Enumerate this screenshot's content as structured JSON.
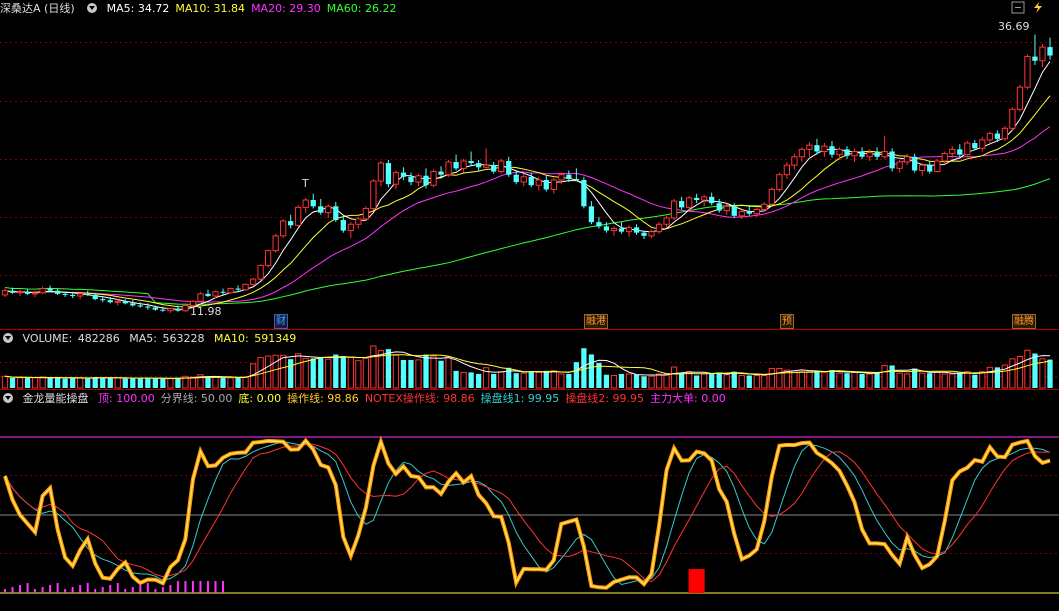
{
  "main": {
    "stock_name": "深桑达A",
    "period": "(日线)",
    "ma": [
      {
        "label": "MA5:",
        "value": "34.72",
        "color": "#ffffff"
      },
      {
        "label": "MA10:",
        "value": "31.84",
        "color": "#ffff33"
      },
      {
        "label": "MA20:",
        "value": "29.30",
        "color": "#ff33ff"
      },
      {
        "label": "MA60:",
        "value": "26.22",
        "color": "#33ff33"
      }
    ],
    "high_label": "36.69",
    "low_label": "11.98",
    "t_marker": "T",
    "tags": [
      {
        "text": "财",
        "color": "#33aaff"
      },
      {
        "text": "融港",
        "color": "#ff9933"
      },
      {
        "text": "预",
        "color": "#ff9933"
      },
      {
        "text": "融腾",
        "color": "#ff9933"
      }
    ]
  },
  "volume": {
    "title": "VOLUME:",
    "value": "482286",
    "ma5_label": "MA5:",
    "ma5": "563228",
    "ma10_label": "MA10:",
    "ma10": "591349"
  },
  "indicator": {
    "name": "金龙量能操盘",
    "items": [
      {
        "label": "顶:",
        "value": "100.00",
        "color": "#ff33ff"
      },
      {
        "label": "分界线:",
        "value": "50.00",
        "color": "#aaaaaa"
      },
      {
        "label": "底:",
        "value": "0.00",
        "color": "#ffff33"
      },
      {
        "label": "操作线:",
        "value": "98.86",
        "color": "#ffcc33"
      },
      {
        "label": "NOTEX操作线:",
        "value": "98.86",
        "color": "#ff3333"
      },
      {
        "label": "操盘线1:",
        "value": "99.95",
        "color": "#33cccc"
      },
      {
        "label": "操盘线2:",
        "value": "99.95",
        "color": "#ff3333"
      },
      {
        "label": "主力大单:",
        "value": "0.00",
        "color": "#ff33ff"
      }
    ]
  },
  "chart_data": {
    "type": "candlestick",
    "candles": [
      [
        12.0,
        12.6,
        11.8,
        12.4
      ],
      [
        12.4,
        12.7,
        12.1,
        12.2
      ],
      [
        12.2,
        12.5,
        11.9,
        12.3
      ],
      [
        12.3,
        12.6,
        12.0,
        12.1
      ],
      [
        12.1,
        12.4,
        11.8,
        12.2
      ],
      [
        12.2,
        12.8,
        12.1,
        12.6
      ],
      [
        12.6,
        12.9,
        12.3,
        12.4
      ],
      [
        12.4,
        12.6,
        12.0,
        12.1
      ],
      [
        12.1,
        12.3,
        11.8,
        12.0
      ],
      [
        12.0,
        12.3,
        11.7,
        11.9
      ],
      [
        11.9,
        12.2,
        11.6,
        12.1
      ],
      [
        12.1,
        12.4,
        11.9,
        12.0
      ],
      [
        12.0,
        12.2,
        11.5,
        11.6
      ],
      [
        11.6,
        11.9,
        11.3,
        11.5
      ],
      [
        11.5,
        11.8,
        11.2,
        11.3
      ],
      [
        11.3,
        11.6,
        11.0,
        11.4
      ],
      [
        11.4,
        11.6,
        11.1,
        11.2
      ],
      [
        11.2,
        11.5,
        10.9,
        11.0
      ],
      [
        11.0,
        11.3,
        10.8,
        10.9
      ],
      [
        10.9,
        11.2,
        10.6,
        10.8
      ],
      [
        10.8,
        11.0,
        10.5,
        10.6
      ],
      [
        10.6,
        10.9,
        10.4,
        10.5
      ],
      [
        10.5,
        10.8,
        10.3,
        10.7
      ],
      [
        10.7,
        11.0,
        10.4,
        10.5
      ],
      [
        10.5,
        11.2,
        10.4,
        11.0
      ],
      [
        11.0,
        11.5,
        10.8,
        11.4
      ],
      [
        11.4,
        12.3,
        11.3,
        12.1
      ],
      [
        12.1,
        12.5,
        11.8,
        11.9
      ],
      [
        11.9,
        12.4,
        11.7,
        12.3
      ],
      [
        12.3,
        12.6,
        12.0,
        12.2
      ],
      [
        12.2,
        12.7,
        12.1,
        12.6
      ],
      [
        12.6,
        12.9,
        12.3,
        12.5
      ],
      [
        12.5,
        13.1,
        12.4,
        13.0
      ],
      [
        13.0,
        13.6,
        12.9,
        13.5
      ],
      [
        13.5,
        14.9,
        13.4,
        14.8
      ],
      [
        14.8,
        16.3,
        14.6,
        16.2
      ],
      [
        16.2,
        17.8,
        16.0,
        17.6
      ],
      [
        17.6,
        19.2,
        17.4,
        19.0
      ],
      [
        19.0,
        19.6,
        18.3,
        18.6
      ],
      [
        18.6,
        20.5,
        18.5,
        20.3
      ],
      [
        20.3,
        21.2,
        19.8,
        21.0
      ],
      [
        21.0,
        21.6,
        20.2,
        20.4
      ],
      [
        20.4,
        21.1,
        19.6,
        19.8
      ],
      [
        19.8,
        20.6,
        19.3,
        20.4
      ],
      [
        20.4,
        20.8,
        18.9,
        19.1
      ],
      [
        19.1,
        19.6,
        17.9,
        18.1
      ],
      [
        18.1,
        18.9,
        17.4,
        18.7
      ],
      [
        18.7,
        19.4,
        18.3,
        19.2
      ],
      [
        19.2,
        20.4,
        19.0,
        20.2
      ],
      [
        20.2,
        23.0,
        20.0,
        22.8
      ],
      [
        22.8,
        24.7,
        22.3,
        24.5
      ],
      [
        24.5,
        24.8,
        22.2,
        22.5
      ],
      [
        22.5,
        23.8,
        22.0,
        23.6
      ],
      [
        23.6,
        24.1,
        22.9,
        23.2
      ],
      [
        23.2,
        23.6,
        22.4,
        22.7
      ],
      [
        22.7,
        23.5,
        22.3,
        23.3
      ],
      [
        23.3,
        24.0,
        22.1,
        22.4
      ],
      [
        22.4,
        23.9,
        22.2,
        23.7
      ],
      [
        23.7,
        24.2,
        23.1,
        23.4
      ],
      [
        23.4,
        24.8,
        23.2,
        24.6
      ],
      [
        24.6,
        25.3,
        23.8,
        24.0
      ],
      [
        24.0,
        24.9,
        23.6,
        24.7
      ],
      [
        24.7,
        25.6,
        24.3,
        24.5
      ],
      [
        24.5,
        24.8,
        23.7,
        24.1
      ],
      [
        24.1,
        25.9,
        24.0,
        24.3
      ],
      [
        24.3,
        24.6,
        23.5,
        23.7
      ],
      [
        23.7,
        24.9,
        23.5,
        24.7
      ],
      [
        24.7,
        25.1,
        23.2,
        23.4
      ],
      [
        23.4,
        23.7,
        22.5,
        22.7
      ],
      [
        22.7,
        23.5,
        22.3,
        23.2
      ],
      [
        23.2,
        23.6,
        22.2,
        22.4
      ],
      [
        22.4,
        23.2,
        21.9,
        22.9
      ],
      [
        22.9,
        23.3,
        21.8,
        22.0
      ],
      [
        22.0,
        23.1,
        21.6,
        22.9
      ],
      [
        22.9,
        23.6,
        22.5,
        23.4
      ],
      [
        23.4,
        23.8,
        22.7,
        23.0
      ],
      [
        23.0,
        24.0,
        22.8,
        22.9
      ],
      [
        22.9,
        23.2,
        20.2,
        20.4
      ],
      [
        20.4,
        20.9,
        18.7,
        18.9
      ],
      [
        18.9,
        19.4,
        18.3,
        18.5
      ],
      [
        18.5,
        18.9,
        17.9,
        18.1
      ],
      [
        18.1,
        18.5,
        17.6,
        18.3
      ],
      [
        18.3,
        18.9,
        17.8,
        18.0
      ],
      [
        18.0,
        18.6,
        17.5,
        18.4
      ],
      [
        18.4,
        18.7,
        17.7,
        17.9
      ],
      [
        17.9,
        18.1,
        17.3,
        17.6
      ],
      [
        17.6,
        18.2,
        17.4,
        18.0
      ],
      [
        18.0,
        18.9,
        17.8,
        18.7
      ],
      [
        18.7,
        19.5,
        18.4,
        19.3
      ],
      [
        19.3,
        21.1,
        19.1,
        20.9
      ],
      [
        20.9,
        21.3,
        20.1,
        20.3
      ],
      [
        20.3,
        21.4,
        20.0,
        21.2
      ],
      [
        21.2,
        21.6,
        20.7,
        21.0
      ],
      [
        21.0,
        21.5,
        20.4,
        21.3
      ],
      [
        21.3,
        21.7,
        20.5,
        20.7
      ],
      [
        20.7,
        21.1,
        19.8,
        20.0
      ],
      [
        20.0,
        20.6,
        19.6,
        20.4
      ],
      [
        20.4,
        20.7,
        19.3,
        19.5
      ],
      [
        19.5,
        20.1,
        19.2,
        19.9
      ],
      [
        19.9,
        20.4,
        19.5,
        19.7
      ],
      [
        19.7,
        20.3,
        19.4,
        20.1
      ],
      [
        20.1,
        20.8,
        19.9,
        20.6
      ],
      [
        20.6,
        22.2,
        20.4,
        22.0
      ],
      [
        22.0,
        23.6,
        21.8,
        23.4
      ],
      [
        23.4,
        24.6,
        23.0,
        24.3
      ],
      [
        24.3,
        25.4,
        23.9,
        25.1
      ],
      [
        25.1,
        26.0,
        24.6,
        25.8
      ],
      [
        25.8,
        26.5,
        25.1,
        26.2
      ],
      [
        26.2,
        26.8,
        25.3,
        25.6
      ],
      [
        25.6,
        26.4,
        25.1,
        26.1
      ],
      [
        26.1,
        26.6,
        25.0,
        25.3
      ],
      [
        25.3,
        26.0,
        24.8,
        25.8
      ],
      [
        25.8,
        26.1,
        24.9,
        25.2
      ],
      [
        25.2,
        25.9,
        24.6,
        25.6
      ],
      [
        25.6,
        26.0,
        24.9,
        25.1
      ],
      [
        25.1,
        25.8,
        24.7,
        25.5
      ],
      [
        25.5,
        26.0,
        24.8,
        25.1
      ],
      [
        25.1,
        27.1,
        24.9,
        25.6
      ],
      [
        25.6,
        25.9,
        23.7,
        24.0
      ],
      [
        24.0,
        24.8,
        23.6,
        24.6
      ],
      [
        24.6,
        25.4,
        24.3,
        25.1
      ],
      [
        25.1,
        25.4,
        23.6,
        23.8
      ],
      [
        23.8,
        24.5,
        23.3,
        24.3
      ],
      [
        24.3,
        24.7,
        23.5,
        23.7
      ],
      [
        23.7,
        24.9,
        23.6,
        24.7
      ],
      [
        24.7,
        25.6,
        24.5,
        25.4
      ],
      [
        25.4,
        26.1,
        25.0,
        25.8
      ],
      [
        25.8,
        26.3,
        25.1,
        25.3
      ],
      [
        25.3,
        26.6,
        25.2,
        26.4
      ],
      [
        26.4,
        26.7,
        25.7,
        25.9
      ],
      [
        25.9,
        27.0,
        25.6,
        26.7
      ],
      [
        26.7,
        27.5,
        26.4,
        27.3
      ],
      [
        27.3,
        27.6,
        26.5,
        26.8
      ],
      [
        26.8,
        28.0,
        26.6,
        27.8
      ],
      [
        27.8,
        29.8,
        27.6,
        29.6
      ],
      [
        29.6,
        31.9,
        29.4,
        31.7
      ],
      [
        31.7,
        34.8,
        31.5,
        34.6
      ],
      [
        34.6,
        36.69,
        33.8,
        34.2
      ],
      [
        34.2,
        35.8,
        33.6,
        35.5
      ],
      [
        35.5,
        36.4,
        34.3,
        34.7
      ]
    ],
    "ma5": "34.72",
    "ma10": "31.84",
    "ma20": "29.30",
    "ma60": "26.22",
    "price_high": 36.69,
    "price_low": 11.98,
    "volume_latest": 482286,
    "operation_line_latest": 98.86
  }
}
